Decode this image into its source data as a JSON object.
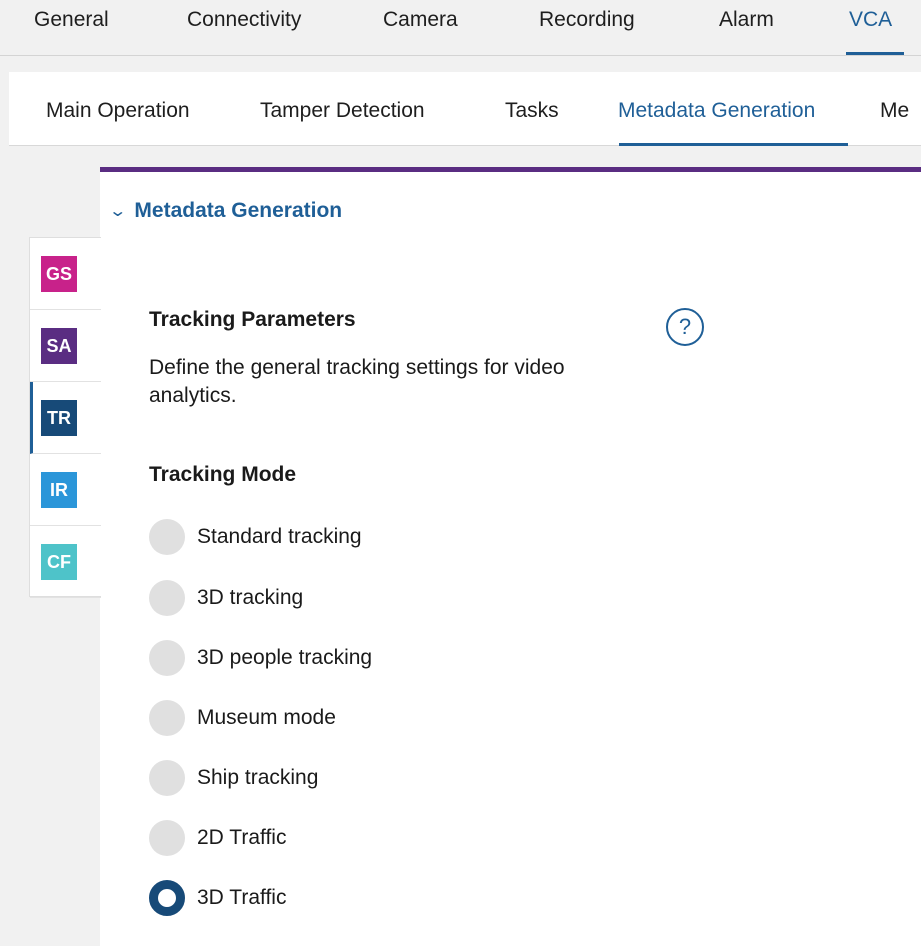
{
  "topnav": {
    "tabs": [
      "General",
      "Connectivity",
      "Camera",
      "Recording",
      "Alarm",
      "VCA"
    ],
    "active": "VCA"
  },
  "subnav": {
    "tabs": [
      "Main Operation",
      "Tamper Detection",
      "Tasks",
      "Metadata Generation",
      "Me"
    ],
    "active": "Metadata Generation"
  },
  "section": {
    "title": "Metadata Generation",
    "expanded": true
  },
  "rail": {
    "items": [
      {
        "label": "GS",
        "color": "#c8228a"
      },
      {
        "label": "SA",
        "color": "#5a2d82"
      },
      {
        "label": "TR",
        "color": "#174a78",
        "active": true
      },
      {
        "label": "IR",
        "color": "#2b96d9"
      },
      {
        "label": "CF",
        "color": "#4ec3c9"
      }
    ]
  },
  "tracking": {
    "title": "Tracking Parameters",
    "description": "Define the general tracking settings for video analytics.",
    "help_symbol": "?",
    "mode_title": "Tracking Mode",
    "options": [
      "Standard tracking",
      "3D tracking",
      "3D people tracking",
      "Museum mode",
      "Ship tracking",
      "2D Traffic",
      "3D Traffic"
    ],
    "selected": "3D Traffic"
  },
  "colors": {
    "accent": "#1f5f97",
    "panel_border": "#5a2d82",
    "radio_checked": "#174a78"
  }
}
